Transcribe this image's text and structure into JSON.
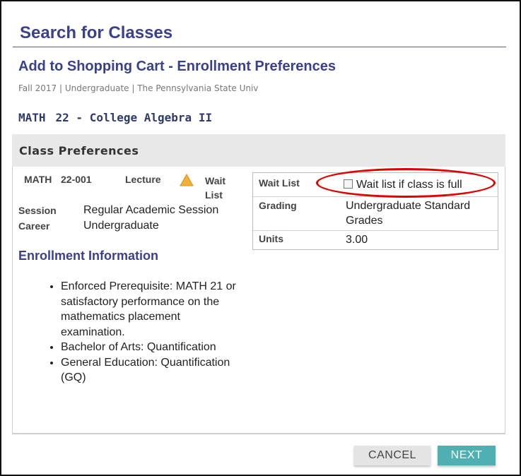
{
  "page": {
    "title": "Search for Classes",
    "subtitle": "Add to Shopping Cart - Enrollment Preferences",
    "term_line": "Fall 2017 | Undergraduate | The Pennsylvania State Univ",
    "course_subject": "MATH",
    "course_number_title": "22 - College Algebra II"
  },
  "preferences": {
    "header": "Class Preferences",
    "section": {
      "subject": "MATH",
      "number": "22-001",
      "component": "Lecture",
      "status_icon": "warning-triangle-icon",
      "status_color": "#f2b134",
      "status_text": "Wait List"
    },
    "session_label": "Session",
    "session_value": "Regular Academic Session",
    "career_label": "Career",
    "career_value": "Undergraduate",
    "table": {
      "waitlist_label": "Wait List",
      "waitlist_checkbox_label": "Wait list if class is full",
      "waitlist_checked": false,
      "grading_label": "Grading",
      "grading_value": "Undergraduate Standard Grades",
      "units_label": "Units",
      "units_value": "3.00"
    },
    "annotation_color": "#e00000"
  },
  "enrollment": {
    "heading": "Enrollment Information",
    "items": [
      "Enforced Prerequisite: MATH 21 or satisfactory performance on the mathematics placement examination.",
      "Bachelor of Arts: Quantification",
      "General Education: Quantification (GQ)"
    ]
  },
  "footer": {
    "cancel_label": "CANCEL",
    "next_label": "NEXT",
    "next_color": "#4fb0b2"
  }
}
